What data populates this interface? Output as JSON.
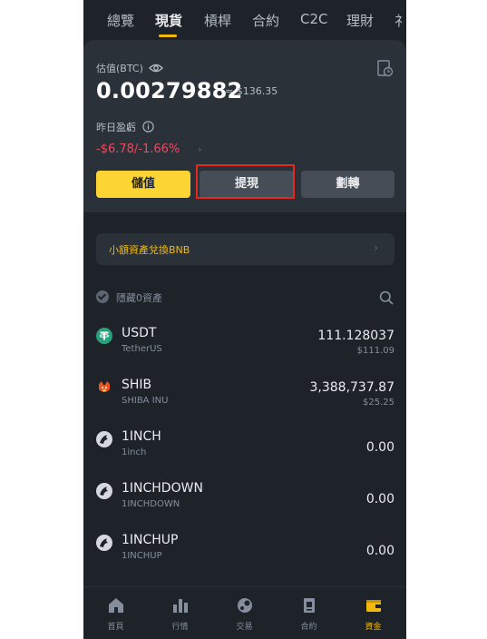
{
  "tabs": [
    {
      "label": "總覽"
    },
    {
      "label": "現貨"
    },
    {
      "label": "槓桿"
    },
    {
      "label": "合約"
    },
    {
      "label": "C2C"
    },
    {
      "label": "理財"
    },
    {
      "label": "礻"
    }
  ],
  "summary": {
    "estimate_label": "估值(BTC)",
    "btc_value": "0.00279882",
    "usd_value": "≈ $136.35",
    "pnl_label": "昨日盈虧",
    "pnl_value": "-$6.78/-1.66%",
    "chevron": "›"
  },
  "actions": {
    "deposit": "儲值",
    "withdraw": "提現",
    "transfer": "劃轉"
  },
  "banner": {
    "text": "小額資產兌換BNB",
    "chevron": "›"
  },
  "filter": {
    "hide_zero_label": "隱藏0資產"
  },
  "assets": [
    {
      "symbol": "USDT",
      "name": "TetherUS",
      "amount": "111.128037",
      "usd": "$111.09",
      "icon": "tether-icon"
    },
    {
      "symbol": "SHIB",
      "name": "SHIBA INU",
      "amount": "3,388,737.87",
      "usd": "$25.25",
      "icon": "shib-icon"
    },
    {
      "symbol": "1INCH",
      "name": "1inch",
      "amount": "0.00",
      "usd": "",
      "icon": "1inch-icon"
    },
    {
      "symbol": "1INCHDOWN",
      "name": "1INCHDOWN",
      "amount": "0.00",
      "usd": "",
      "icon": "1inch-icon"
    },
    {
      "symbol": "1INCHUP",
      "name": "1INCHUP",
      "amount": "0.00",
      "usd": "",
      "icon": "1inch-icon"
    }
  ],
  "nav": [
    {
      "label": "首頁",
      "icon": "home-icon"
    },
    {
      "label": "行情",
      "icon": "markets-icon"
    },
    {
      "label": "交易",
      "icon": "trade-icon"
    },
    {
      "label": "合約",
      "icon": "futures-icon"
    },
    {
      "label": "資金",
      "icon": "wallet-icon"
    }
  ],
  "colors": {
    "accent": "#f0b90b",
    "negative": "#f6465d",
    "background": "#1e2329",
    "highlight_box": "#e22b1e"
  }
}
